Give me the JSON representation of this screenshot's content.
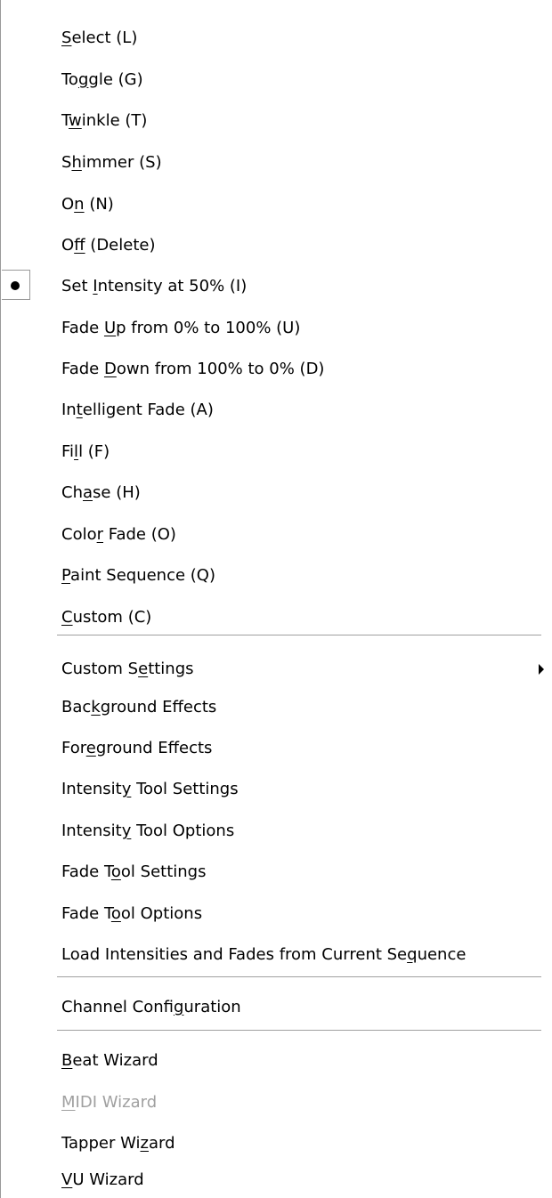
{
  "menu": {
    "items": [
      {
        "pre": "",
        "key": "S",
        "post": "elect (L)"
      },
      {
        "pre": "To",
        "key": "g",
        "post": "gle (G)"
      },
      {
        "pre": "T",
        "key": "w",
        "post": "inkle (T)"
      },
      {
        "pre": "S",
        "key": "h",
        "post": "immer (S)"
      },
      {
        "pre": "O",
        "key": "n",
        "post": " (N)"
      },
      {
        "pre": "O",
        "key": "f",
        "post": "f (Delete)"
      },
      {
        "pre": "Set ",
        "key": "I",
        "post": "ntensity at 50% (I)",
        "checked": "bullet"
      },
      {
        "pre": "Fade ",
        "key": "U",
        "post": "p from 0% to 100% (U)"
      },
      {
        "pre": "Fade ",
        "key": "D",
        "post": "own from 100% to 0% (D)"
      },
      {
        "pre": "In",
        "key": "t",
        "post": "elligent Fade (A)"
      },
      {
        "pre": "Fi",
        "key": "l",
        "post": "l (F)"
      },
      {
        "pre": "Ch",
        "key": "a",
        "post": "se (H)"
      },
      {
        "pre": "Colo",
        "key": "r",
        "post": " Fade (O)"
      },
      {
        "pre": "",
        "key": "P",
        "post": "aint Sequence (Q)"
      },
      {
        "pre": "",
        "key": "C",
        "post": "ustom (C)"
      },
      {
        "pre": "Custom S",
        "key": "e",
        "post": "ttings",
        "submenu": "submenu-arrow"
      },
      {
        "pre": "Bac",
        "key": "k",
        "post": "ground Effects"
      },
      {
        "pre": "For",
        "key": "e",
        "post": "ground Effects"
      },
      {
        "pre": "Intensit",
        "key": "y",
        "post": " Tool Settings"
      },
      {
        "pre": "Intensit",
        "key": "y",
        "post": " Tool Options"
      },
      {
        "pre": "Fade T",
        "key": "o",
        "post": "ol Settings"
      },
      {
        "pre": "Fade T",
        "key": "o",
        "post": "ol Options"
      },
      {
        "pre": "Load Intensities and Fades from Current Se",
        "key": "q",
        "post": "uence"
      },
      {
        "pre": "Channel Confi",
        "key": "g",
        "post": "uration"
      },
      {
        "pre": "",
        "key": "B",
        "post": "eat Wizard"
      },
      {
        "pre": "",
        "key": "M",
        "post": "IDI Wizard",
        "disabled": "disabled"
      },
      {
        "pre": "Tapper Wi",
        "key": "z",
        "post": "ard"
      },
      {
        "pre": "",
        "key": "V",
        "post": "U Wizard"
      }
    ]
  }
}
